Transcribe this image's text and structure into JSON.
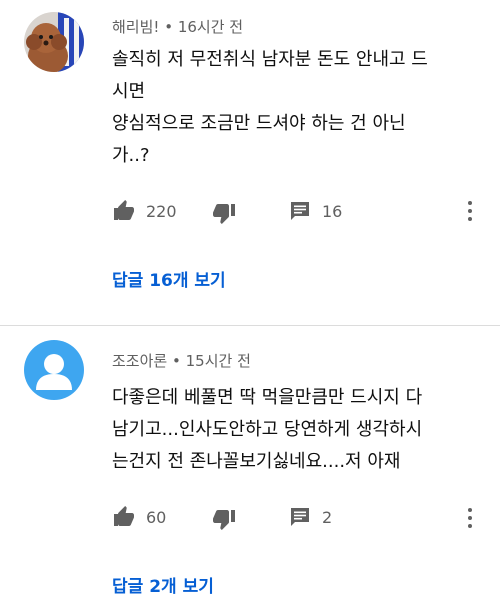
{
  "comments": [
    {
      "author": "해리빔!",
      "time": "16시간 전",
      "text": "솔직히 저 무전취식 남자분 돈도 안내고 드\n시면\n양심적으로 조금만 드셔야 하는 건 아닌\n가..?",
      "likes": "220",
      "replies_count": "16",
      "view_replies": "답글 16개 보기",
      "avatar": "dog-photo"
    },
    {
      "author": "조조아론",
      "time": "15시간 전",
      "text": "다좋은데 베풀면 딱 먹을만큼만 드시지 다\n남기고...인사도안하고 당연하게 생각하시\n는건지 전  존나꼴보기싫네요....저 아재",
      "likes": "60",
      "replies_count": "2",
      "view_replies": "답글 2개 보기",
      "avatar": "default-person-icon"
    }
  ],
  "separator": "•",
  "colors": {
    "link": "#065fd4",
    "meta": "#606060",
    "avatar_default": "#3ea6f0"
  }
}
